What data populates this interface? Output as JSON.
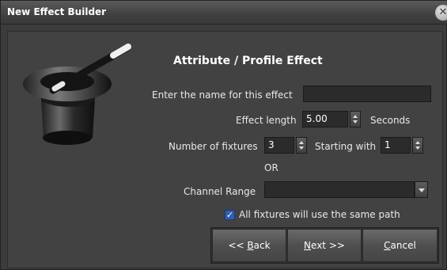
{
  "window": {
    "title": "New Effect Builder",
    "close_glyph": "✕"
  },
  "heading": "Attribute / Profile Effect",
  "name_field": {
    "label": "Enter the name for this effect",
    "value": ""
  },
  "length_field": {
    "label": "Effect length",
    "value": "5.00",
    "unit": "Seconds"
  },
  "fixtures_field": {
    "label": "Number of fixtures",
    "value": "3"
  },
  "starting_field": {
    "label": "Starting with",
    "value": "1"
  },
  "or_label": "OR",
  "channel_range": {
    "label": "Channel Range",
    "value": ""
  },
  "same_path": {
    "label": "All fixtures will use the same path",
    "checked": true
  },
  "buttons": {
    "back": {
      "prefix": "<< ",
      "mnemonic": "B",
      "rest": "ack"
    },
    "next": {
      "mnemonic": "N",
      "rest": "ext >>"
    },
    "cancel": {
      "mnemonic": "C",
      "rest": "ancel"
    }
  },
  "icons": {
    "hero": "magic-hat-icon",
    "close": "close-icon"
  }
}
